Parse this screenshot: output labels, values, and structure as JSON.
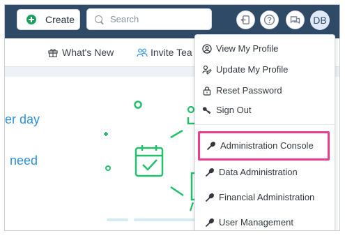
{
  "topbar": {
    "create_label": "Create",
    "search_placeholder": "Search",
    "avatar_initials": "DB",
    "icons": [
      "sign-out-icon",
      "help-icon",
      "chat-icon"
    ]
  },
  "subbar": {
    "whats_new_label": "What's New",
    "invite_team_label": "Invite Tea"
  },
  "hero": {
    "line1": "er day",
    "line2": "need"
  },
  "menu": {
    "items": [
      {
        "label": "View My Profile",
        "icon": "user-circle-icon"
      },
      {
        "label": "Update My Profile",
        "icon": "user-edit-icon"
      },
      {
        "label": "Reset Password",
        "icon": "lock-icon"
      },
      {
        "label": "Sign Out",
        "icon": "key-icon"
      },
      {
        "label": "Administration Console",
        "icon": "wrench-icon"
      },
      {
        "label": "Data Administration",
        "icon": "wrench-icon"
      },
      {
        "label": "Financial Administration",
        "icon": "wrench-icon"
      },
      {
        "label": "User Management",
        "icon": "wrench-icon"
      }
    ],
    "highlighted_item": "Administration Console",
    "highlight_color": "#e83e8c"
  },
  "colors": {
    "topbar": "#2e4a67",
    "accent_green": "#18a05f",
    "hero_text": "#2f8fd6",
    "illustration_green": "#22c06a"
  }
}
